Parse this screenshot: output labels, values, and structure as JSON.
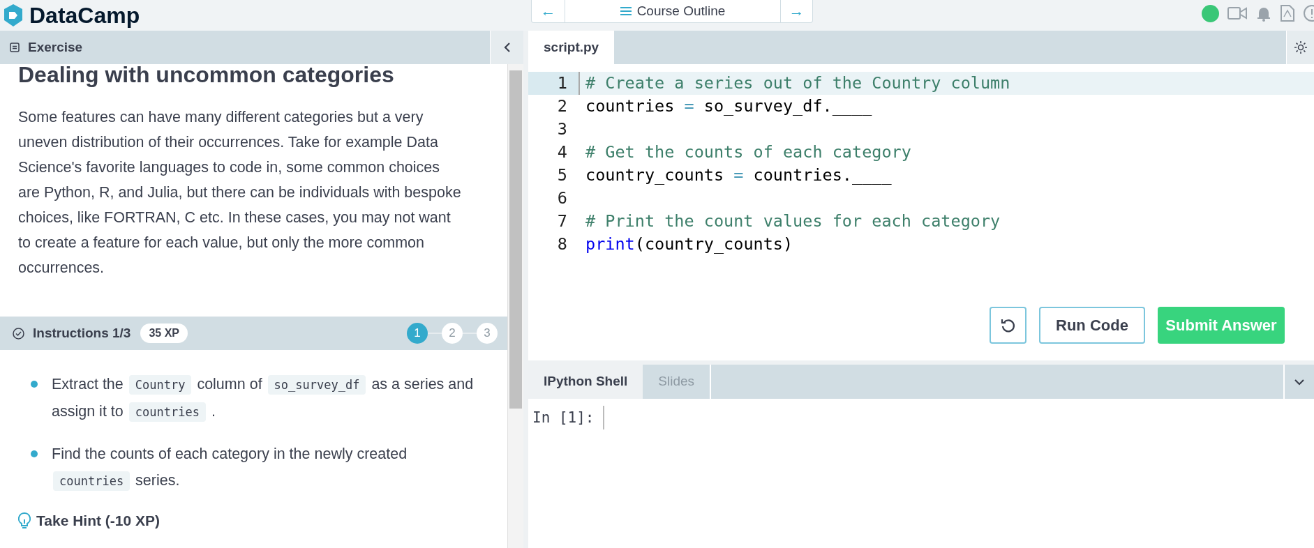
{
  "topbar": {
    "logo": "DataCamp",
    "outline_label": "Course Outline",
    "prev_symbol": "←",
    "next_symbol": "→"
  },
  "exercise": {
    "header": "Exercise",
    "title": "Dealing with uncommon categories",
    "paragraph": "Some features can have many different categories but a very uneven distribution of their occurrences. Take for example Data Science's favorite languages to code in, some common choices are Python, R, and Julia, but there can be individuals with bespoke choices, like FORTRAN, C etc. In these cases, you may not want to create a feature for each value, but only the more common occurrences."
  },
  "instructions": {
    "header": "Instructions 1/3",
    "xp": "35 XP",
    "steps": [
      {
        "label": "1",
        "selected": true
      },
      {
        "label": "2",
        "selected": false
      },
      {
        "label": "3",
        "selected": false
      }
    ],
    "items": [
      [
        {
          "kind": "text",
          "text": "Extract the"
        },
        {
          "kind": "code",
          "text": "Country"
        },
        {
          "kind": "text",
          "text": "column of"
        },
        {
          "kind": "code",
          "text": "so_survey_df"
        },
        {
          "kind": "text",
          "text": "as a series and assign it to"
        },
        {
          "kind": "code",
          "text": "countries"
        },
        {
          "kind": "text",
          "text": "."
        }
      ],
      [
        {
          "kind": "text",
          "text": "Find the counts of each category in the newly created"
        },
        {
          "kind": "code",
          "text": "countries"
        },
        {
          "kind": "text",
          "text": "series."
        }
      ]
    ],
    "hint": "Take Hint (-10 XP)"
  },
  "editor": {
    "tabs": [
      {
        "label": "script.py",
        "selected": true
      }
    ],
    "lines": [
      {
        "number": "1",
        "active": true,
        "tokens": [
          {
            "kind": "comment",
            "text": "# Create a series out of the Country column"
          }
        ]
      },
      {
        "number": "2",
        "active": false,
        "tokens": [
          {
            "kind": "plain",
            "text": "countries "
          },
          {
            "kind": "operator",
            "text": "="
          },
          {
            "kind": "plain",
            "text": " so_survey_df.____"
          }
        ]
      },
      {
        "number": "3",
        "active": false
      },
      {
        "number": "4",
        "active": false,
        "tokens": [
          {
            "kind": "comment",
            "text": "# Get the counts of each category"
          }
        ]
      },
      {
        "number": "5",
        "active": false,
        "tokens": [
          {
            "kind": "plain",
            "text": "country_counts "
          },
          {
            "kind": "operator",
            "text": "="
          },
          {
            "kind": "plain",
            "text": " countries.____"
          }
        ]
      },
      {
        "number": "6",
        "active": false
      },
      {
        "number": "7",
        "active": false,
        "tokens": [
          {
            "kind": "comment",
            "text": "# Print the count values for each category"
          }
        ]
      },
      {
        "number": "8",
        "active": false,
        "tokens": [
          {
            "kind": "keyword",
            "text": "print"
          },
          {
            "kind": "plain",
            "text": "(country_counts)"
          }
        ]
      }
    ],
    "run_label": "Run Code",
    "submit_label": "Submit Answer"
  },
  "console": {
    "tabs": [
      {
        "label": "IPython Shell",
        "selected": true
      },
      {
        "label": "Slides",
        "selected": false
      }
    ],
    "prompt": "In [1]:"
  }
}
